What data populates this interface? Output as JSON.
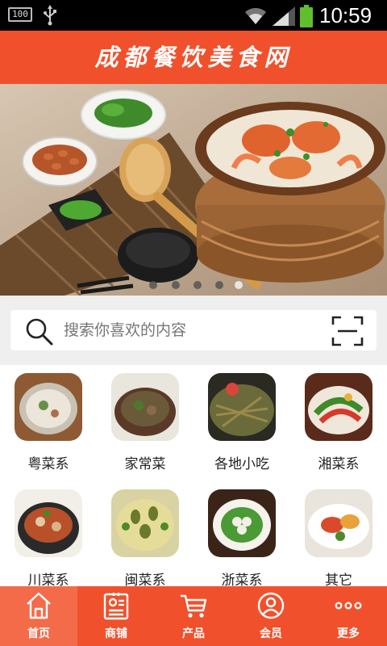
{
  "status_bar": {
    "battery_percent": "100",
    "time": "10:59",
    "icons": [
      "battery-icon",
      "usb-icon",
      "wifi-icon",
      "signal-icon",
      "battery-charging-icon"
    ]
  },
  "header": {
    "title": "成都餐饮美食网",
    "color": "#f0512c"
  },
  "banner": {
    "slide_count": 5,
    "active_slide": 5
  },
  "search": {
    "placeholder": "搜索你喜欢的内容",
    "icon": "search-icon",
    "scan_icon": "scan-icon"
  },
  "categories": [
    {
      "label": "粤菜系"
    },
    {
      "label": "家常菜"
    },
    {
      "label": "各地小吃"
    },
    {
      "label": "湘菜系"
    },
    {
      "label": "川菜系"
    },
    {
      "label": "闽菜系"
    },
    {
      "label": "浙菜系"
    },
    {
      "label": "其它"
    }
  ],
  "bottom_nav": {
    "items": [
      {
        "label": "首页",
        "icon": "home-icon",
        "active": true
      },
      {
        "label": "商铺",
        "icon": "shop-card-icon",
        "active": false
      },
      {
        "label": "产品",
        "icon": "cart-icon",
        "active": false
      },
      {
        "label": "会员",
        "icon": "member-icon",
        "active": false
      },
      {
        "label": "更多",
        "icon": "more-icon",
        "active": false
      }
    ]
  }
}
